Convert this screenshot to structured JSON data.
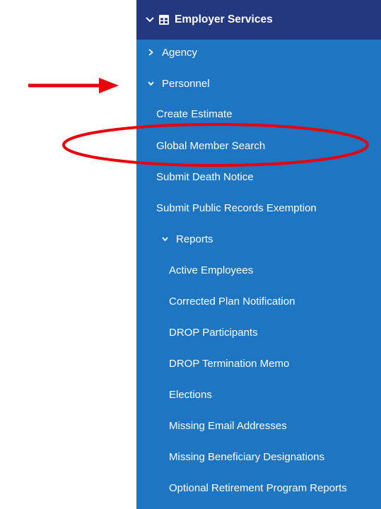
{
  "sidebar": {
    "header": {
      "title": "Employer Services",
      "expand_icon": "chevron-down-icon",
      "section_icon": "table-grid-icon"
    },
    "agency": {
      "label": "Agency",
      "icon": "chevron-right-icon"
    },
    "personnel": {
      "label": "Personnel",
      "icon": "chevron-down-icon"
    },
    "personnel_items": [
      {
        "label": "Create Estimate"
      },
      {
        "label": "Global Member Search"
      },
      {
        "label": "Submit Death Notice"
      },
      {
        "label": "Submit Public Records Exemption"
      }
    ],
    "reports": {
      "label": "Reports",
      "icon": "chevron-down-icon"
    },
    "report_items": [
      {
        "label": "Active Employees"
      },
      {
        "label": "Corrected Plan Notification"
      },
      {
        "label": "DROP Participants"
      },
      {
        "label": "DROP Termination Memo"
      },
      {
        "label": "Elections"
      },
      {
        "label": "Missing Email Addresses"
      },
      {
        "label": "Missing Beneficiary Designations"
      },
      {
        "label": "Optional Retirement Program Reports"
      }
    ]
  },
  "annotations": {
    "arrow_color": "#e8000b",
    "ellipse_color": "#e8000b"
  },
  "colors": {
    "header_bg": "#24387f",
    "sidebar_bg": "#1e76c2",
    "text": "#ffffff"
  }
}
